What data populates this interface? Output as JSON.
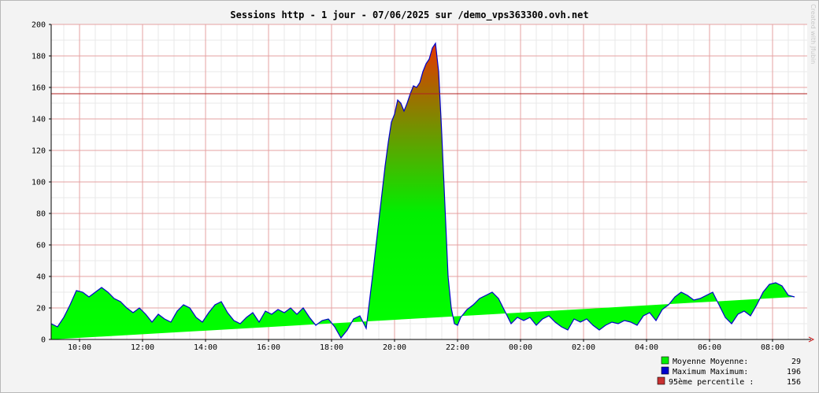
{
  "chart_data": {
    "type": "area",
    "title": "Sessions http - 1 jour - 07/06/2025 sur /demo_vps363300.ovh.net",
    "watermark": "Created with Jfubin",
    "xlabel": "",
    "ylabel": "",
    "ylim": [
      0,
      200
    ],
    "y_ticks": [
      "0",
      "20",
      "40",
      "60",
      "80",
      "100",
      "120",
      "140",
      "160",
      "180",
      "200"
    ],
    "x_ticks": [
      {
        "hour": 10,
        "label": "10:00"
      },
      {
        "hour": 12,
        "label": "12:00"
      },
      {
        "hour": 14,
        "label": "14:00"
      },
      {
        "hour": 16,
        "label": "16:00"
      },
      {
        "hour": 18,
        "label": "18:00"
      },
      {
        "hour": 20,
        "label": "20:00"
      },
      {
        "hour": 22,
        "label": "22:00"
      },
      {
        "hour": 24,
        "label": "00:00"
      },
      {
        "hour": 26,
        "label": "02:00"
      },
      {
        "hour": 28,
        "label": "04:00"
      },
      {
        "hour": 30,
        "label": "06:00"
      },
      {
        "hour": 32,
        "label": "08:00"
      }
    ],
    "xlim_hours": [
      9.1,
      33.1
    ],
    "percentile_95": 156,
    "grid": true,
    "colors": {
      "area_low": "#00ff00",
      "area_high": "#ff2000",
      "max_line": "#0000cc",
      "percentile_line": "#b02020",
      "grid_major": "#e6a0a0",
      "grid_minor": "#e8e8e8",
      "plot_bg": "#ffffff",
      "legend_moyenne": "#00ee00",
      "legend_maximum": "#0000cc",
      "legend_percentile": "#c83030"
    },
    "series": [
      {
        "name": "Moyenne",
        "x_hours": [
          9.1,
          9.3,
          9.5,
          9.7,
          9.9,
          10.1,
          10.3,
          10.5,
          10.7,
          10.9,
          11.1,
          11.3,
          11.5,
          11.7,
          11.9,
          12.1,
          12.3,
          12.5,
          12.7,
          12.9,
          13.1,
          13.3,
          13.5,
          13.7,
          13.9,
          14.1,
          14.3,
          14.5,
          14.7,
          14.9,
          15.1,
          15.3,
          15.5,
          15.7,
          15.9,
          16.1,
          16.3,
          16.5,
          16.7,
          16.9,
          17.1,
          17.3,
          17.5,
          17.7,
          17.9,
          18.1,
          18.3,
          18.5,
          18.7,
          18.9,
          19.1,
          19.3,
          19.5,
          19.7,
          19.8,
          19.9,
          20.0,
          20.1,
          20.2,
          20.3,
          20.4,
          20.5,
          20.6,
          20.7,
          20.8,
          20.9,
          21.0,
          21.1,
          21.2,
          21.3,
          21.4,
          21.5,
          21.6,
          21.7,
          21.8,
          21.9,
          22.0,
          22.1,
          22.3,
          22.5,
          22.7,
          22.9,
          23.1,
          23.3,
          23.5,
          23.7,
          23.9,
          24.1,
          24.3,
          24.5,
          24.7,
          24.9,
          25.1,
          25.3,
          25.5,
          25.7,
          25.9,
          26.1,
          26.3,
          26.5,
          26.7,
          26.9,
          27.1,
          27.3,
          27.5,
          27.7,
          27.9,
          28.1,
          28.3,
          28.5,
          28.7,
          28.9,
          29.1,
          29.3,
          29.5,
          29.7,
          29.9,
          30.1,
          30.3,
          30.5,
          30.7,
          30.9,
          31.1,
          31.3,
          31.5,
          31.7,
          31.9,
          32.1,
          32.3,
          32.5,
          32.7,
          32.9,
          33.1
        ],
        "values": [
          10,
          8,
          14,
          22,
          31,
          30,
          27,
          30,
          33,
          30,
          26,
          24,
          20,
          17,
          20,
          16,
          11,
          16,
          13,
          11,
          18,
          22,
          20,
          14,
          11,
          17,
          22,
          24,
          17,
          12,
          10,
          14,
          17,
          11,
          18,
          16,
          19,
          17,
          20,
          16,
          20,
          14,
          9,
          12,
          13,
          8,
          1,
          6,
          13,
          15,
          7,
          40,
          75,
          110,
          125,
          138,
          143,
          152,
          150,
          145,
          150,
          156,
          161,
          160,
          163,
          170,
          175,
          178,
          185,
          188,
          170,
          130,
          85,
          40,
          20,
          10,
          9,
          14,
          19,
          22,
          26,
          28,
          30,
          26,
          18,
          10,
          14,
          12,
          14,
          9,
          13,
          15,
          11,
          8,
          6,
          13,
          11,
          13,
          9,
          6,
          9,
          11,
          10,
          12,
          11,
          9,
          15,
          17,
          12,
          19,
          22,
          27,
          30,
          28,
          25,
          26,
          28,
          30,
          22,
          14,
          10,
          16,
          18,
          15,
          22,
          30,
          35,
          36,
          34,
          28,
          27
        ]
      }
    ],
    "legend": [
      {
        "label": "Moyenne  Moyenne:",
        "value": "29"
      },
      {
        "label": "Maximum  Maximum:",
        "value": "196"
      },
      {
        "label": "95ème percentile  :",
        "value": "156"
      }
    ]
  }
}
